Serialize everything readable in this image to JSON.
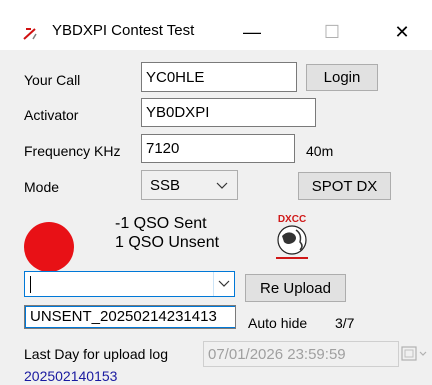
{
  "window": {
    "title": "YBDXPI Contest Test",
    "minimize_glyph": "—",
    "maximize_glyph": "☐",
    "close_glyph": "✕"
  },
  "form": {
    "your_call_label": "Your Call",
    "your_call_value": "YC0HLE",
    "login_label": "Login",
    "activator_label": "Activator",
    "activator_value": "YB0DXPI",
    "frequency_label": "Frequency KHz",
    "frequency_value": "7120",
    "band_value": "40m",
    "mode_label": "Mode",
    "mode_value": "SSB",
    "spot_dx_label": "SPOT DX"
  },
  "status": {
    "led_color": "#e81116",
    "sent_text": "-1 QSO Sent",
    "unsent_text": "1 QSO Unsent",
    "logo_text": "DXCC"
  },
  "upload": {
    "combo_value": "",
    "dropdown_item": "UNSENT_20250214231413",
    "re_upload_label": "Re Upload",
    "auto_hide_label": "Auto hide",
    "counter": "3/7"
  },
  "footer": {
    "last_day_label": "Last Day for upload  log",
    "last_day_value": "07/01/2026 23:59:59",
    "session_id": "202502140153"
  },
  "colors": {
    "accent": "#0078d7",
    "session_id_color": "#1a1aa0"
  }
}
